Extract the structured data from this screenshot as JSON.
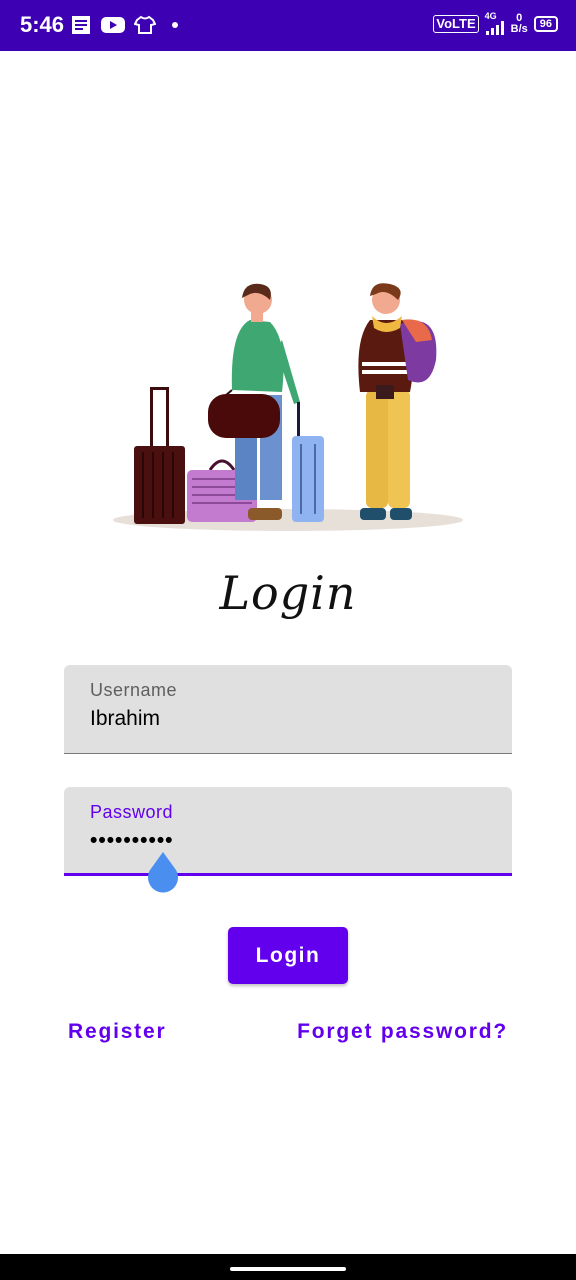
{
  "status_bar": {
    "time": "5:46",
    "network": "VoLTE",
    "signal": "4G",
    "speed_value": "0",
    "speed_unit": "B/s",
    "battery": "96",
    "icons": [
      "document-icon",
      "youtube-icon",
      "shirt-icon",
      "dot-icon",
      "signal-icon"
    ]
  },
  "form": {
    "title": "Login",
    "username": {
      "label": "Username",
      "value": "Ibrahim"
    },
    "password": {
      "label": "Password",
      "value": "••••••••••"
    },
    "login_button": "Login",
    "register_link": "Register",
    "forget_link": "Forget password?"
  },
  "colors": {
    "status_bar": "#3d00b3",
    "accent": "#6200ee",
    "field_bg": "#e0e0e0",
    "handle": "#4a8ef0"
  }
}
